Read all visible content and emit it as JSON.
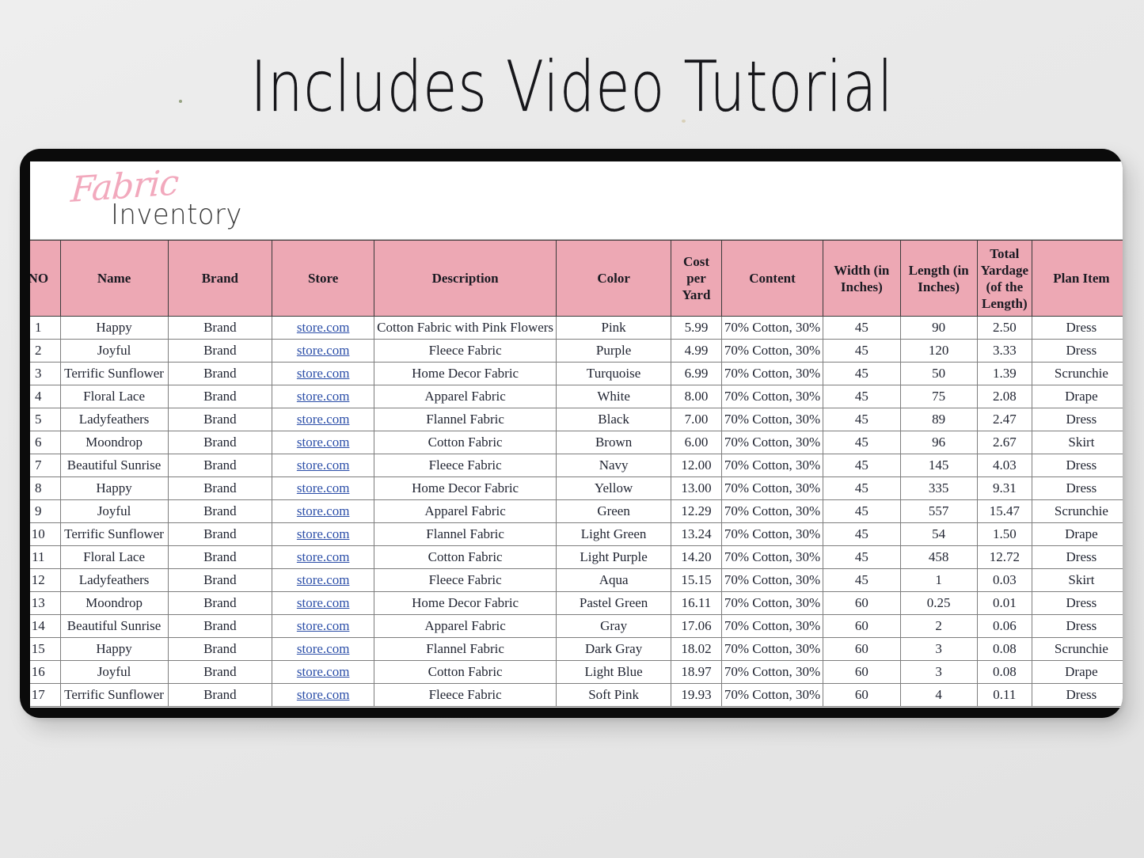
{
  "headline": "Includes Video Tutorial",
  "logo": {
    "script": "Fabric",
    "sub": "Inventory"
  },
  "colors": {
    "header_pink": "#eda8b4",
    "link_blue": "#2b4ea8",
    "frame_black": "#0b0b0b",
    "page_background": "#e8e8e8",
    "script_pink": "#f2a9bd"
  },
  "table": {
    "headers": [
      "NO",
      "Name",
      "Brand",
      "Store",
      "Description",
      "Color",
      "Cost per Yard",
      "Content",
      "Width (in Inches)",
      "Length (in Inches)",
      "Total Yardage (of the Length)",
      "Plan Item"
    ],
    "headers_display": {
      "no": "NO",
      "name": "Name",
      "brand": "Brand",
      "store": "Store",
      "description": "Description",
      "color": "Color",
      "cost": "Cost per Yard",
      "content": "Content",
      "width": "Width (in Inches)",
      "length": "Length (in Inches)",
      "yardage": "Total Yardage (of the Length)",
      "plan": "Plan Item"
    },
    "rows": [
      {
        "no": "1",
        "name": "Happy",
        "brand": "Brand",
        "store": "store.com",
        "description": "Cotton Fabric with Pink Flowers",
        "color": "Pink",
        "cost": "5.99",
        "content": "70% Cotton, 30%",
        "width": "45",
        "length": "90",
        "yardage": "2.50",
        "plan": "Dress"
      },
      {
        "no": "2",
        "name": "Joyful",
        "brand": "Brand",
        "store": "store.com",
        "description": "Fleece Fabric",
        "color": "Purple",
        "cost": "4.99",
        "content": "70% Cotton, 30%",
        "width": "45",
        "length": "120",
        "yardage": "3.33",
        "plan": "Dress"
      },
      {
        "no": "3",
        "name": "Terrific Sunflower",
        "brand": "Brand",
        "store": "store.com",
        "description": "Home Decor Fabric",
        "color": "Turquoise",
        "cost": "6.99",
        "content": "70% Cotton, 30%",
        "width": "45",
        "length": "50",
        "yardage": "1.39",
        "plan": "Scrunchie"
      },
      {
        "no": "4",
        "name": "Floral Lace",
        "brand": "Brand",
        "store": "store.com",
        "description": "Apparel Fabric",
        "color": "White",
        "cost": "8.00",
        "content": "70% Cotton, 30%",
        "width": "45",
        "length": "75",
        "yardage": "2.08",
        "plan": "Drape"
      },
      {
        "no": "5",
        "name": "Ladyfeathers",
        "brand": "Brand",
        "store": "store.com",
        "description": "Flannel Fabric",
        "color": "Black",
        "cost": "7.00",
        "content": "70% Cotton, 30%",
        "width": "45",
        "length": "89",
        "yardage": "2.47",
        "plan": "Dress"
      },
      {
        "no": "6",
        "name": "Moondrop",
        "brand": "Brand",
        "store": "store.com",
        "description": "Cotton Fabric",
        "color": "Brown",
        "cost": "6.00",
        "content": "70% Cotton, 30%",
        "width": "45",
        "length": "96",
        "yardage": "2.67",
        "plan": "Skirt"
      },
      {
        "no": "7",
        "name": "Beautiful Sunrise",
        "brand": "Brand",
        "store": "store.com",
        "description": "Fleece Fabric",
        "color": "Navy",
        "cost": "12.00",
        "content": "70% Cotton, 30%",
        "width": "45",
        "length": "145",
        "yardage": "4.03",
        "plan": "Dress"
      },
      {
        "no": "8",
        "name": "Happy",
        "brand": "Brand",
        "store": "store.com",
        "description": "Home Decor Fabric",
        "color": "Yellow",
        "cost": "13.00",
        "content": "70% Cotton, 30%",
        "width": "45",
        "length": "335",
        "yardage": "9.31",
        "plan": "Dress"
      },
      {
        "no": "9",
        "name": "Joyful",
        "brand": "Brand",
        "store": "store.com",
        "description": "Apparel Fabric",
        "color": "Green",
        "cost": "12.29",
        "content": "70% Cotton, 30%",
        "width": "45",
        "length": "557",
        "yardage": "15.47",
        "plan": "Scrunchie"
      },
      {
        "no": "10",
        "name": "Terrific Sunflower",
        "brand": "Brand",
        "store": "store.com",
        "description": "Flannel Fabric",
        "color": "Light Green",
        "cost": "13.24",
        "content": "70% Cotton, 30%",
        "width": "45",
        "length": "54",
        "yardage": "1.50",
        "plan": "Drape"
      },
      {
        "no": "11",
        "name": "Floral Lace",
        "brand": "Brand",
        "store": "store.com",
        "description": "Cotton Fabric",
        "color": "Light Purple",
        "cost": "14.20",
        "content": "70% Cotton, 30%",
        "width": "45",
        "length": "458",
        "yardage": "12.72",
        "plan": "Dress"
      },
      {
        "no": "12",
        "name": "Ladyfeathers",
        "brand": "Brand",
        "store": "store.com",
        "description": "Fleece Fabric",
        "color": "Aqua",
        "cost": "15.15",
        "content": "70% Cotton, 30%",
        "width": "45",
        "length": "1",
        "yardage": "0.03",
        "plan": "Skirt"
      },
      {
        "no": "13",
        "name": "Moondrop",
        "brand": "Brand",
        "store": "store.com",
        "description": "Home Decor Fabric",
        "color": "Pastel Green",
        "cost": "16.11",
        "content": "70% Cotton, 30%",
        "width": "60",
        "length": "0.25",
        "yardage": "0.01",
        "plan": "Dress"
      },
      {
        "no": "14",
        "name": "Beautiful Sunrise",
        "brand": "Brand",
        "store": "store.com",
        "description": "Apparel Fabric",
        "color": "Gray",
        "cost": "17.06",
        "content": "70% Cotton, 30%",
        "width": "60",
        "length": "2",
        "yardage": "0.06",
        "plan": "Dress"
      },
      {
        "no": "15",
        "name": "Happy",
        "brand": "Brand",
        "store": "store.com",
        "description": "Flannel Fabric",
        "color": "Dark Gray",
        "cost": "18.02",
        "content": "70% Cotton, 30%",
        "width": "60",
        "length": "3",
        "yardage": "0.08",
        "plan": "Scrunchie"
      },
      {
        "no": "16",
        "name": "Joyful",
        "brand": "Brand",
        "store": "store.com",
        "description": "Cotton Fabric",
        "color": "Light Blue",
        "cost": "18.97",
        "content": "70% Cotton, 30%",
        "width": "60",
        "length": "3",
        "yardage": "0.08",
        "plan": "Drape"
      },
      {
        "no": "17",
        "name": "Terrific Sunflower",
        "brand": "Brand",
        "store": "store.com",
        "description": "Fleece Fabric",
        "color": "Soft Pink",
        "cost": "19.93",
        "content": "70% Cotton, 30%",
        "width": "60",
        "length": "4",
        "yardage": "0.11",
        "plan": "Dress"
      }
    ]
  }
}
